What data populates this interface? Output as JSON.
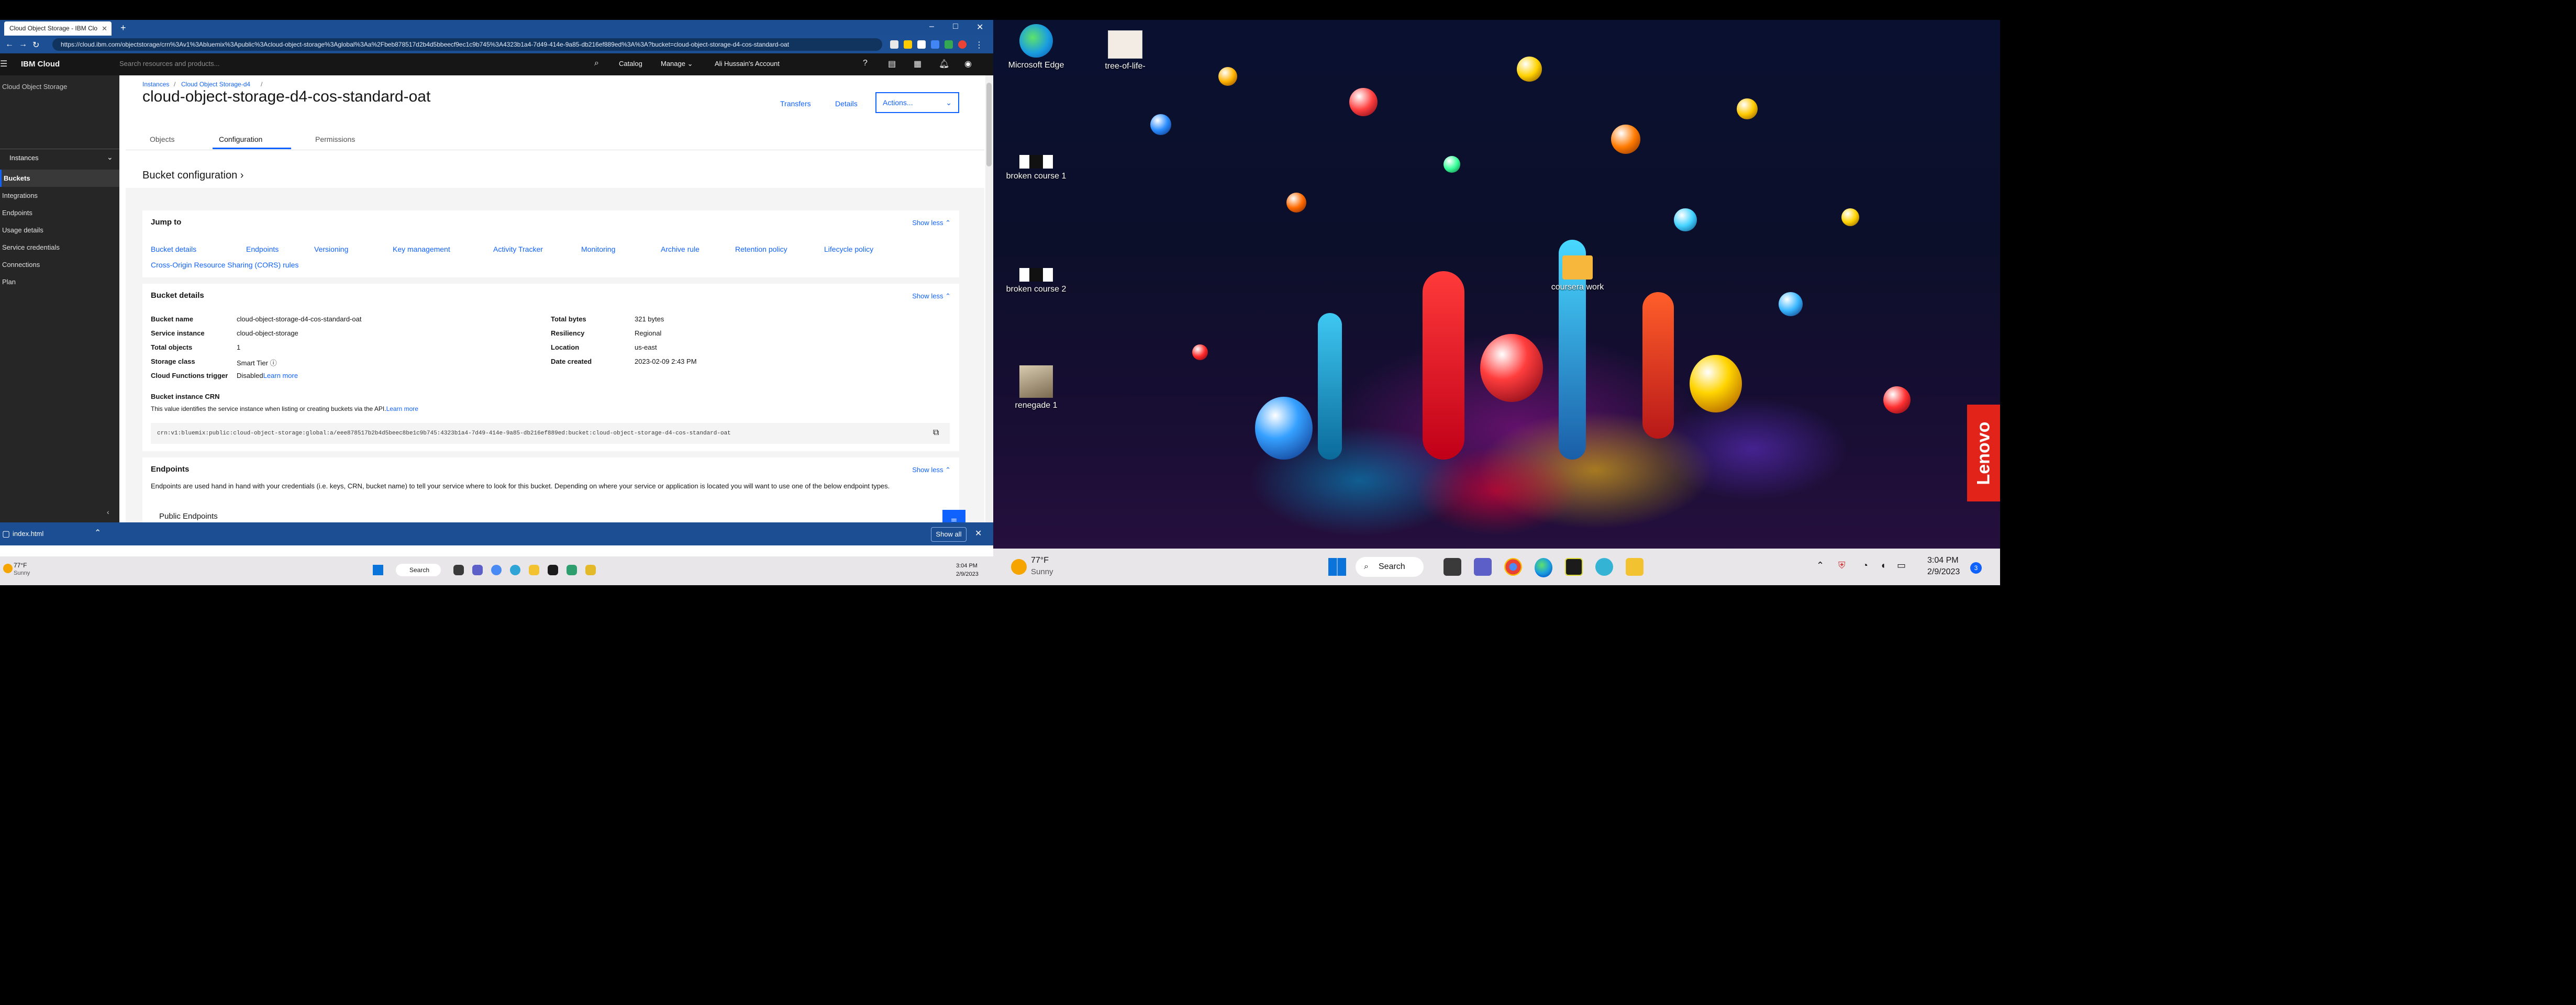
{
  "browser": {
    "tab_title": "Cloud Object Storage - IBM Clo",
    "new_tab": "+",
    "url": "https://cloud.ibm.com/objectstorage/crn%3Av1%3Abluemix%3Apublic%3Acloud-object-storage%3Aglobal%3Aa%2Fbeb878517d2b4d5bbeecf9ec1c9b745%3A4323b1a4-7d49-414e-9a85-db216ef889ed%3A%3A?bucket=cloud-object-storage-d4-cos-standard-oat",
    "win_min": "–",
    "win_max": "□",
    "win_close": "✕"
  },
  "ibm_header": {
    "brand": "IBM Cloud",
    "search_placeholder": "Search resources and products...",
    "catalog": "Catalog",
    "manage": "Manage",
    "account": "Ali Hussain's Account"
  },
  "sidebar": {
    "service": "Cloud Object Storage",
    "instances": "Instances",
    "items": [
      {
        "label": "Buckets"
      },
      {
        "label": "Integrations"
      },
      {
        "label": "Endpoints"
      },
      {
        "label": "Usage details"
      },
      {
        "label": "Service credentials"
      },
      {
        "label": "Connections"
      },
      {
        "label": "Plan"
      }
    ]
  },
  "main": {
    "breadcrumb": [
      "Instances",
      "Cloud Object Storage-d4"
    ],
    "title": "cloud-object-storage-d4-cos-standard-oat",
    "transfers": "Transfers",
    "details": "Details",
    "actions": "Actions...",
    "tabs": [
      {
        "label": "Objects"
      },
      {
        "label": "Configuration"
      },
      {
        "label": "Permissions"
      }
    ],
    "section_heading": "Bucket configuration",
    "jump_to": {
      "title": "Jump to",
      "show_less": "Show less",
      "links": [
        "Bucket details",
        "Endpoints",
        "Versioning",
        "Key management",
        "Activity Tracker",
        "Monitoring",
        "Archive rule",
        "Retention policy",
        "Lifecycle policy"
      ],
      "links_row2": "Cross-Origin Resource Sharing (CORS) rules"
    },
    "bucket_details": {
      "title": "Bucket details",
      "show_less": "Show less",
      "left": [
        {
          "label": "Bucket name",
          "value": "cloud-object-storage-d4-cos-standard-oat"
        },
        {
          "label": "Service instance",
          "value": "cloud-object-storage"
        },
        {
          "label": "Total objects",
          "value": "1"
        },
        {
          "label": "Storage class",
          "value": "Smart Tier"
        },
        {
          "label": "Cloud Functions trigger",
          "value": "Disabled"
        }
      ],
      "learn_more": "Learn more",
      "right": [
        {
          "label": "Total bytes",
          "value": "321 bytes"
        },
        {
          "label": "Resiliency",
          "value": "Regional"
        },
        {
          "label": "Location",
          "value": "us-east"
        },
        {
          "label": "Date created",
          "value": "2023-02-09 2:43 PM"
        }
      ],
      "crn_title": "Bucket instance CRN",
      "crn_desc": "This value identifies the service instance when listing or creating buckets via the API.",
      "crn_learn_more": "Learn more",
      "crn_value": "crn:v1:bluemix:public:cloud-object-storage:global:a/eee878517b2b4d5beec8be1c9b745:4323b1a4-7d49-414e-9a85-db216ef889ed:bucket:cloud-object-storage-d4-cos-standard-oat"
    },
    "endpoints": {
      "title": "Endpoints",
      "show_less": "Show less",
      "desc": "Endpoints are used hand in hand with your credentials (i.e. keys, CRN, bucket name) to tell your service where to look for this bucket. Depending on where your service or application is located you will want to use one of the below endpoint types.",
      "next": "Public Endpoints"
    }
  },
  "downloads": {
    "file": "index.html",
    "show_all": "Show all"
  },
  "taskbar_left": {
    "weather_temp": "77°F",
    "weather_desc": "Sunny",
    "search": "Search",
    "time": "3:04 PM",
    "date": "2/9/2023"
  },
  "desktop": {
    "icons": [
      {
        "label": "Microsoft Edge"
      },
      {
        "label": "tree-of-life-"
      },
      {
        "label": "broken course 1"
      },
      {
        "label": "broken course 2"
      },
      {
        "label": "coursera work"
      },
      {
        "label": "renegade 1"
      }
    ],
    "lenovo": "Lenovo"
  },
  "taskbar_right": {
    "weather_temp": "77°F",
    "weather_desc": "Sunny",
    "search": "Search",
    "time": "3:04 PM",
    "date": "2/9/2023",
    "notif_count": "3"
  },
  "colors": {
    "ibm_blue": "#0f62fe",
    "browser_chrome": "#1c4e93",
    "header_dark": "#161616",
    "sidebar_dark": "#262626"
  }
}
